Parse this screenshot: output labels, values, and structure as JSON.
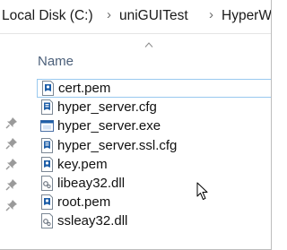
{
  "breadcrumb": {
    "items": [
      "Local Disk (C:)",
      "uniGUITest",
      "HyperWS"
    ],
    "separator": "›"
  },
  "list": {
    "name_column": "Name",
    "files": [
      {
        "name": "cert.pem",
        "icon": "pem-certificate-icon",
        "selected": true
      },
      {
        "name": "hyper_server.cfg",
        "icon": "config-file-icon"
      },
      {
        "name": "hyper_server.exe",
        "icon": "exe-application-icon"
      },
      {
        "name": "hyper_server.ssl.cfg",
        "icon": "config-file-icon"
      },
      {
        "name": "key.pem",
        "icon": "pem-certificate-icon"
      },
      {
        "name": "libeay32.dll",
        "icon": "dll-file-icon"
      },
      {
        "name": "root.pem",
        "icon": "pem-certificate-icon"
      },
      {
        "name": "ssleay32.dll",
        "icon": "dll-file-icon"
      }
    ]
  },
  "colors": {
    "selection_border": "#99c9ef",
    "column_header_text": "#4c607a",
    "icon_blue": "#1f5fa8"
  }
}
